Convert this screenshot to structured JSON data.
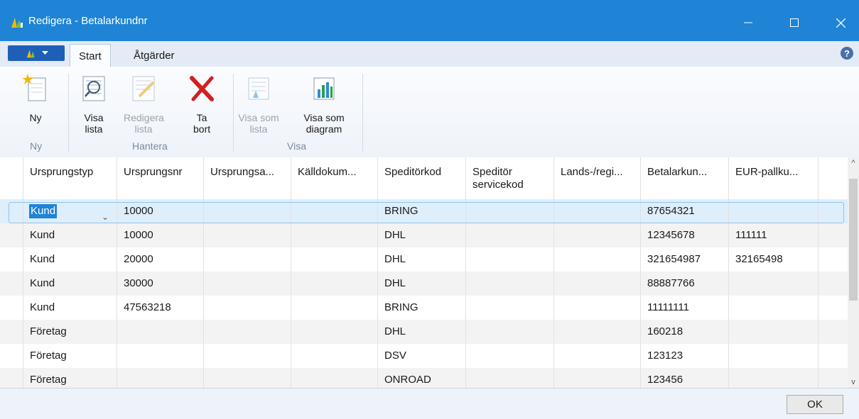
{
  "window": {
    "title": "Redigera - Betalarkundnr",
    "minimize_icon": "minimize-icon",
    "maximize_icon": "maximize-icon",
    "close_icon": "close-icon"
  },
  "ribbon_tabs": [
    {
      "label": "Start"
    },
    {
      "label": "Åtgärder"
    }
  ],
  "ribbon": {
    "new_label": "Ny",
    "show_list_label": "Visa lista",
    "edit_list_label": "Redigera lista",
    "delete_label": "Ta bort",
    "view_as_list_label": "Visa som lista",
    "view_as_chart_label": "Visa som diagram",
    "group_new": "Ny",
    "group_manage": "Hantera",
    "group_view": "Visa"
  },
  "columns": [
    "Ursprungstyp",
    "Ursprungsnr",
    "Ursprungsa...",
    "Källdokum...",
    "Speditörkod",
    "Speditör servicekod",
    "Lands-/regi...",
    "Betalarkun...",
    "EUR-pallku..."
  ],
  "rows": [
    [
      "Kund",
      "10000",
      "",
      "",
      "BRING",
      "",
      "",
      "87654321",
      ""
    ],
    [
      "Kund",
      "10000",
      "",
      "",
      "DHL",
      "",
      "",
      "12345678",
      "111111"
    ],
    [
      "Kund",
      "20000",
      "",
      "",
      "DHL",
      "",
      "",
      "321654987",
      "32165498"
    ],
    [
      "Kund",
      "30000",
      "",
      "",
      "DHL",
      "",
      "",
      "88887766",
      ""
    ],
    [
      "Kund",
      "47563218",
      "",
      "",
      "BRING",
      "",
      "",
      "11111111",
      ""
    ],
    [
      "Företag",
      "",
      "",
      "",
      "DHL",
      "",
      "",
      "160218",
      ""
    ],
    [
      "Företag",
      "",
      "",
      "",
      "DSV",
      "",
      "",
      "123123",
      ""
    ],
    [
      "Företag",
      "",
      "",
      "",
      "ONROAD",
      "",
      "",
      "123456",
      ""
    ]
  ],
  "footer": {
    "ok_label": "OK"
  },
  "colors": {
    "titlebar": "#1f84d6",
    "selection": "#1f84d6"
  }
}
